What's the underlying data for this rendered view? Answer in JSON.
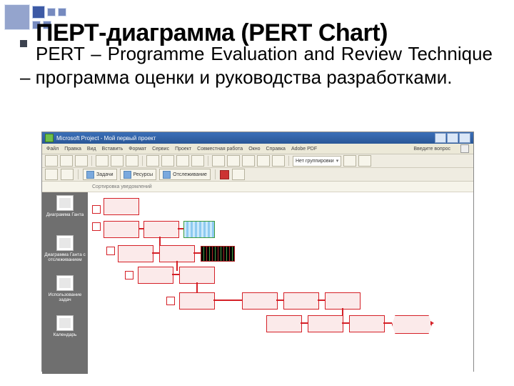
{
  "title": "ПЕРТ-диаграмма (PERT Chart)",
  "bullet": "PERT – Programme Evaluation and Review Technique – программа оценки и руководства разработками.",
  "app": {
    "title": "Microsoft Project - Мой первый проект",
    "menu": [
      "Файл",
      "Правка",
      "Вид",
      "Вставить",
      "Формат",
      "Сервис",
      "Проект",
      "Совместная работа",
      "Окно",
      "Справка",
      "Adobe PDF"
    ],
    "question_hint": "Введите вопрос",
    "toolbar": {
      "combo1": "Нет группировки"
    },
    "toolbar2": {
      "btn1": "Задачи",
      "btn2": "Ресурсы",
      "btn3": "Отслеживание"
    },
    "subheader": "Сортировка уведомлений",
    "sidebar": [
      "Диаграмма Ганта",
      "Диаграмма Ганта с отслеживанием",
      "Использование задач",
      "Календарь"
    ]
  }
}
